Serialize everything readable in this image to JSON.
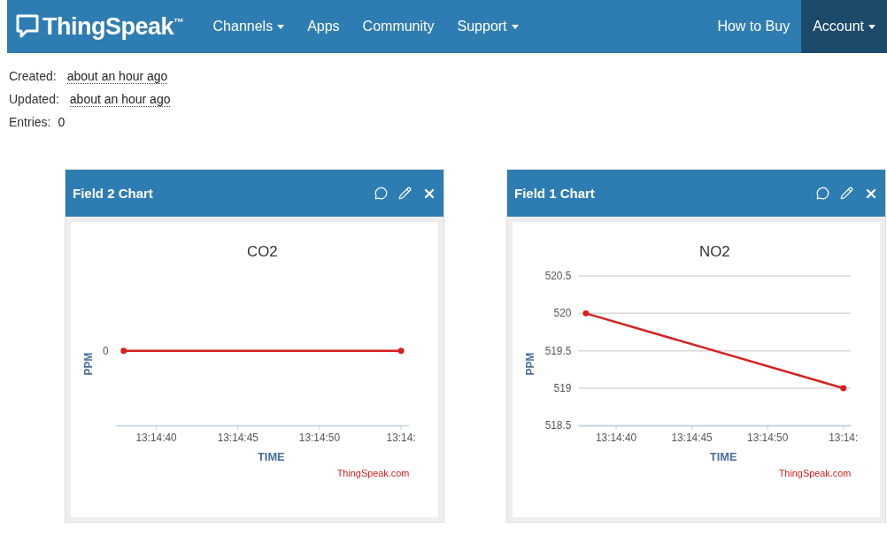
{
  "navbar": {
    "logo": "ThingSpeak$^{™}$",
    "items": [
      {
        "label": "Channels",
        "dropdown": true,
        "selected": false
      },
      {
        "label": "Apps",
        "dropdown": false,
        "selected": false
      },
      {
        "label": "Community",
        "dropdown": false,
        "selected": false
      },
      {
        "label": "Support",
        "dropdown": true,
        "selected": false
      }
    ],
    "right_items": [
      {
        "label": "How to Buy",
        "dropdown": false,
        "selected": false
      },
      {
        "label": "Account",
        "dropdown": true,
        "selected": true
      }
    ]
  },
  "meta": [
    {
      "label": "Created:",
      "value": "about an hour ago",
      "kind": "time"
    },
    {
      "label": "Updated:",
      "value": "about an hour ago",
      "kind": "time"
    },
    {
      "label": "Entries:",
      "value": "0",
      "kind": "plain"
    }
  ],
  "panels": [
    {
      "title": "Field 2 Chart",
      "credit": "ThingSpeak.com",
      "x_axis_labels": [
        "13:14:40",
        "13:14:45",
        "13:14:50",
        "13:14:"
      ],
      "plot": {
        "kind": "flat_line",
        "title": "CO2",
        "xlabel": "TIME",
        "ylabel": "PPM",
        "y_label": "0",
        "color": "#d62020"
      }
    },
    {
      "title": "Field 1 Chart",
      "credit": "ThingSpeak.com",
      "x_axis_labels": [
        "13:14:40",
        "13:14:45",
        "13:14:50",
        "13:14:"
      ],
      "chart_data": {
        "type": "line",
        "title": "NO2",
        "xlabel": "TIME",
        "ylabel": "PPM",
        "categories": [
          null,
          null,
          null,
          null,
          null,
          null,
          null,
          null,
          null,
          null,
          null,
          null,
          null,
          null,
          null,
          null,
          null,
          null
        ],
        "ylim": [
          518.5,
          520.5
        ],
        "yticks": [
          518.5,
          519,
          519.5,
          520,
          520.5
        ],
        "grid": true,
        "series": [
          {
            "color": "#d62020",
            "marker": true,
            "values": [
              520,
              null,
              null,
              null,
              null,
              null,
              null,
              null,
              null,
              null,
              null,
              null,
              null,
              null,
              null,
              null,
              null,
              519
            ]
          }
        ]
      }
    }
  ]
}
